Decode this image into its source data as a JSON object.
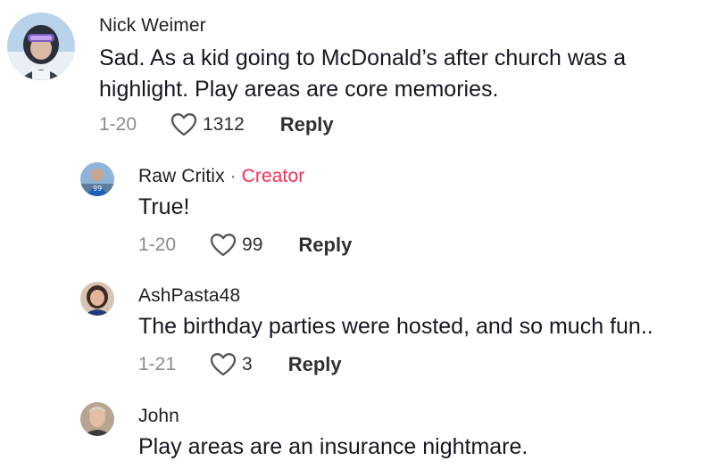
{
  "comments": [
    {
      "author": "Nick Weimer",
      "badge": "",
      "text_lines": [
        "Sad. As a kid going to McDonald’s after church was a",
        "highlight. Play areas are core memories."
      ],
      "date": "1-20",
      "likes": "1312",
      "reply_label": "Reply",
      "icons": {
        "like": "heart-outline-icon"
      }
    },
    {
      "author": "Raw Critix",
      "separator": "·",
      "badge": "Creator",
      "text_lines": [
        "True!"
      ],
      "date": "1-20",
      "likes": "99",
      "reply_label": "Reply",
      "icons": {
        "like": "heart-outline-icon"
      }
    },
    {
      "author": "AshPasta48",
      "badge": "",
      "text_lines": [
        "The birthday parties were hosted, and so much fun.."
      ],
      "date": "1-21",
      "likes": "3",
      "reply_label": "Reply",
      "icons": {
        "like": "heart-outline-icon"
      }
    },
    {
      "author": "John",
      "badge": "",
      "text_lines": [
        "Play areas are an insurance nightmare."
      ]
    }
  ],
  "colors": {
    "creator_badge": "#fe2c55",
    "text": "#161823",
    "muted": "#8a8b91"
  }
}
